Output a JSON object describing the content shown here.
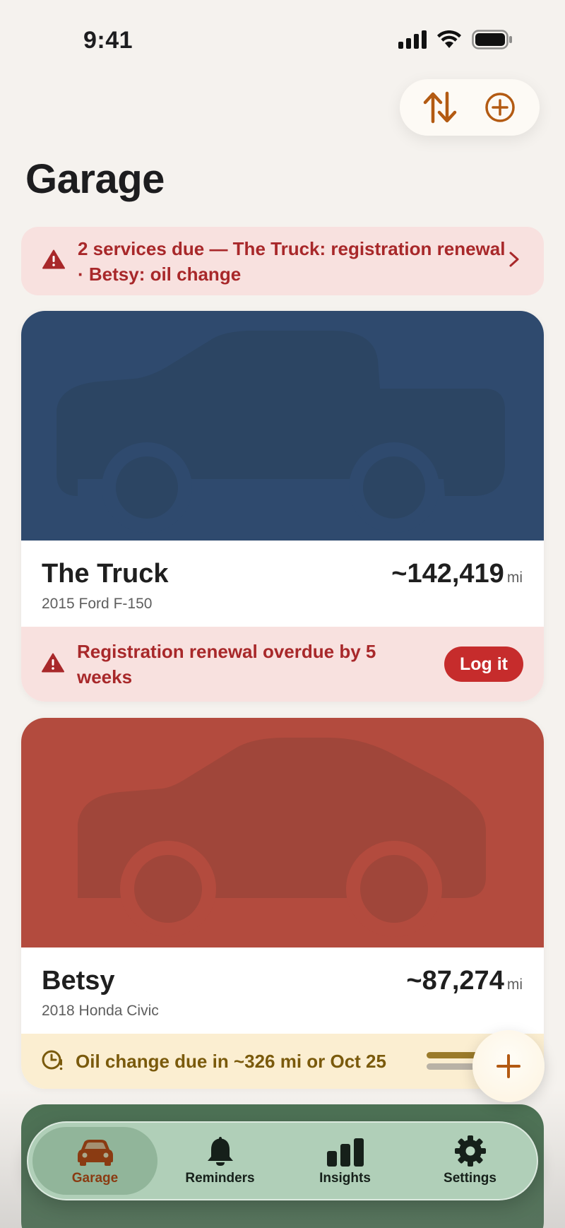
{
  "status_bar": {
    "time": "9:41"
  },
  "header": {
    "title": "Garage"
  },
  "summary_alert": {
    "text": "2 services due — The Truck: registration renewal · Betsy: oil change"
  },
  "vehicles": [
    {
      "name": "The Truck",
      "subtitle": "2015 Ford F-150",
      "mileage": "~142,419",
      "mileage_unit": "mi",
      "hero_color": "#2f4a6e",
      "alert_text": "Registration renewal overdue by 5 weeks",
      "action_label": "Log it"
    },
    {
      "name": "Betsy",
      "subtitle": "2018 Honda Civic",
      "mileage": "~87,274",
      "mileage_unit": "mi",
      "hero_color": "#b34b3e",
      "due_text": "Oil change due in ~326 mi or Oct 25"
    }
  ],
  "tabs": [
    {
      "label": "Garage",
      "icon": "car-icon",
      "active": true
    },
    {
      "label": "Reminders",
      "icon": "bell-icon",
      "active": false
    },
    {
      "label": "Insights",
      "icon": "bar-chart-icon",
      "active": false
    },
    {
      "label": "Settings",
      "icon": "gear-icon",
      "active": false
    }
  ],
  "colors": {
    "accent": "#b35a12",
    "alert_bg": "#f8e1df",
    "alert_text": "#a8282a",
    "due_bg": "#fbeed1",
    "tab_bar_bg": "#b9d7c0",
    "third_vehicle": "#4b7153"
  }
}
